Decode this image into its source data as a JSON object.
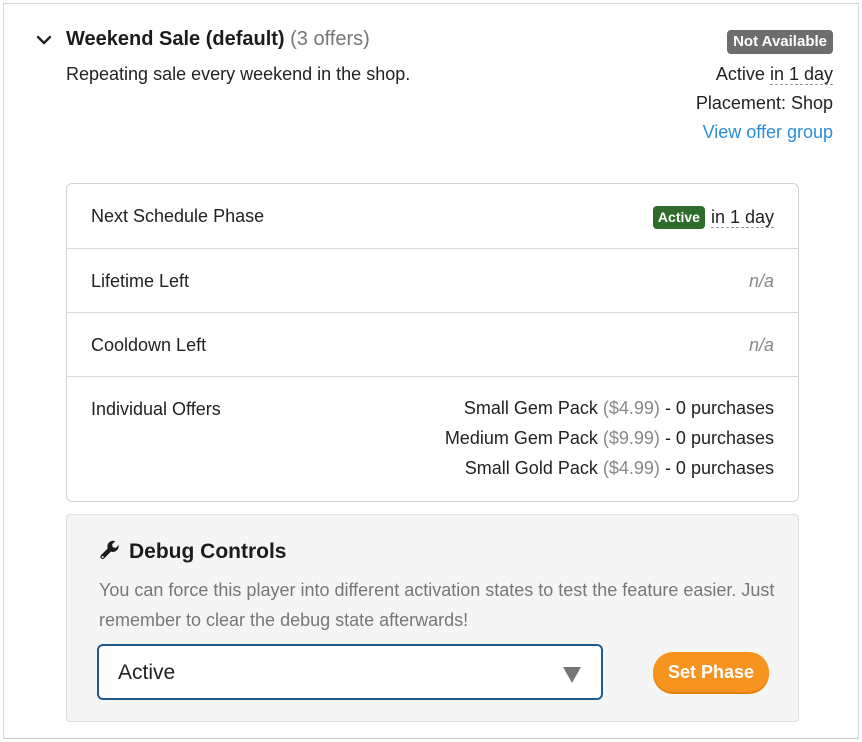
{
  "header": {
    "title": "Weekend Sale (default)",
    "offer_count": "(3 offers)",
    "description": "Repeating sale every weekend in the shop.",
    "status_badge": "Not Available",
    "active_prefix": "Active",
    "active_when": "in 1 day",
    "placement": "Placement: Shop",
    "view_link": "View offer group"
  },
  "details": {
    "next_phase_label": "Next Schedule Phase",
    "next_phase_badge": "Active",
    "next_phase_when": "in 1 day",
    "lifetime_label": "Lifetime Left",
    "lifetime_value": "n/a",
    "cooldown_label": "Cooldown Left",
    "cooldown_value": "n/a",
    "offers_label": "Individual Offers",
    "offers": [
      {
        "name": "Small Gem Pack",
        "price": "($4.99)",
        "purchases": "- 0 purchases"
      },
      {
        "name": "Medium Gem Pack",
        "price": "($9.99)",
        "purchases": "- 0 purchases"
      },
      {
        "name": "Small Gold Pack",
        "price": "($4.99)",
        "purchases": "- 0 purchases"
      }
    ]
  },
  "debug": {
    "title": "Debug Controls",
    "description": "You can force this player into different activation states to test the feature easier. Just remember to clear the debug state afterwards!",
    "selected_phase": "Active",
    "set_button": "Set Phase"
  },
  "colors": {
    "link": "#2b8ddb",
    "active_badge": "#2f6b2a",
    "na_badge": "#6d6d6d",
    "button": "#f7941f"
  }
}
